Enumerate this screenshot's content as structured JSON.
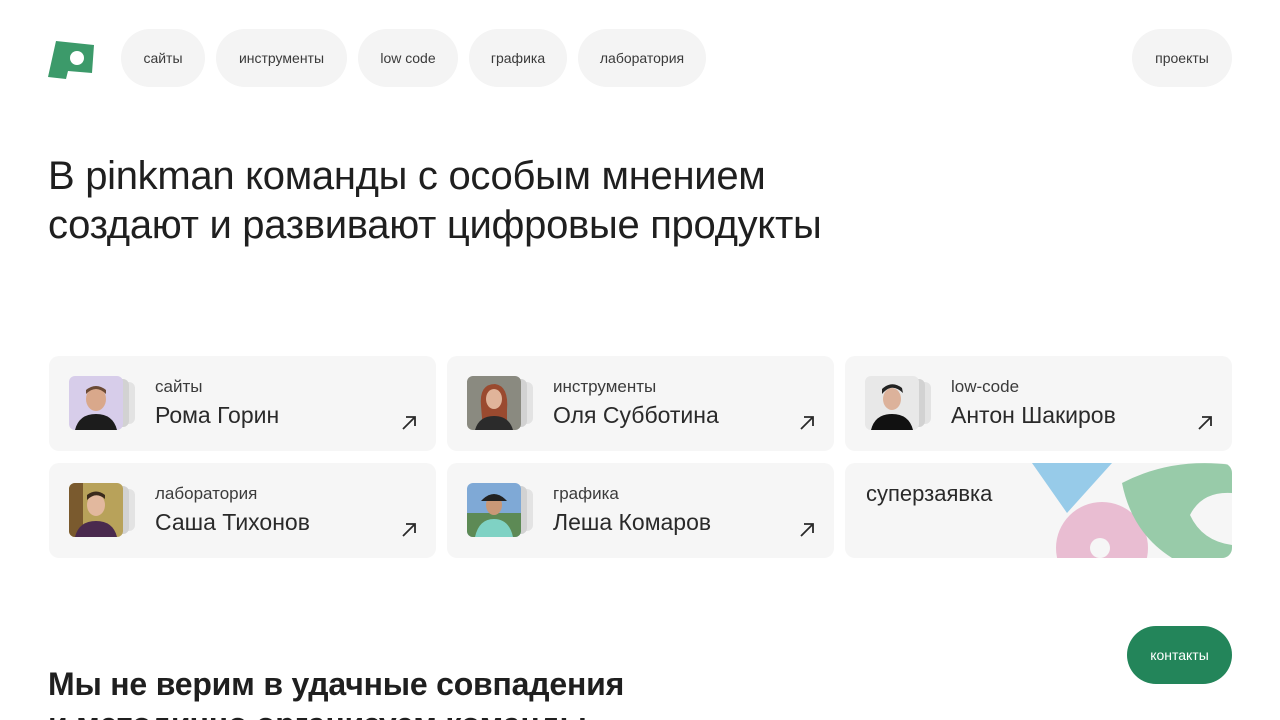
{
  "header": {
    "nav": [
      {
        "label": "сайты"
      },
      {
        "label": "инструменты"
      },
      {
        "label": "low code"
      },
      {
        "label": "графика"
      },
      {
        "label": "лаборатория"
      }
    ],
    "projects_label": "проекты"
  },
  "hero": {
    "line1": "В pinkman команды с особым мнением",
    "line2": "создают и развивают цифровые продукты"
  },
  "teams": [
    {
      "category": "сайты",
      "name": "Рома Горин"
    },
    {
      "category": "инструменты",
      "name": "Оля Субботина"
    },
    {
      "category": "low-code",
      "name": "Антон Шакиров"
    },
    {
      "category": "лаборатория",
      "name": "Саша Тихонов"
    },
    {
      "category": "графика",
      "name": "Леша Комаров"
    }
  ],
  "super_card": {
    "label": "суперзаявка"
  },
  "lower": {
    "line1": "Мы не верим в удачные совпадения",
    "line2": "и методично организуем команды"
  },
  "contacts_label": "контакты",
  "colors": {
    "brand_green": "#23855a",
    "logo_green": "#3c9a6a",
    "pill_bg": "#f4f4f4",
    "card_bg": "#f6f6f6",
    "deco_blue": "#97cbe9",
    "deco_pink": "#e9bdd2",
    "deco_green": "#98cba9"
  }
}
